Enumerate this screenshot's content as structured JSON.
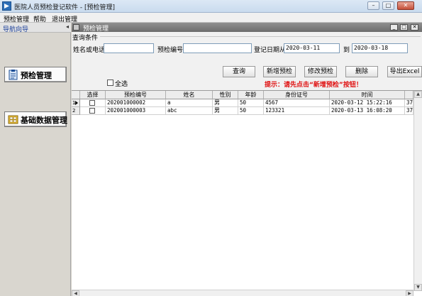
{
  "window": {
    "title": "医院人员预检登记软件 - [预检管理]",
    "minimize_glyph": "–",
    "maximize_glyph": "□",
    "close_glyph": "✕"
  },
  "menubar": {
    "items": [
      "预检管理",
      "帮助",
      "退出管理"
    ]
  },
  "sidebar": {
    "title": "导航向导",
    "collapse_glyph": "◂",
    "buttons": [
      {
        "label": "预检管理",
        "icon": "clipboard-icon"
      },
      {
        "label": "基础数据管理",
        "icon": "database-icon"
      }
    ]
  },
  "child_window": {
    "title": "预检管理",
    "buttons": [
      "_",
      "□",
      "✕"
    ]
  },
  "query": {
    "group_label": "查询条件",
    "name_phone_label": "姓名或电话",
    "name_phone_value": "",
    "precheck_no_label": "预检编号",
    "precheck_no_value": "",
    "date_from_label": "登记日期从",
    "date_from_value": "2020-03-11",
    "date_to_label": "到",
    "date_to_value": "2020-03-18"
  },
  "actions": {
    "query": "查询",
    "add": "新增预检",
    "edit": "修改预检",
    "delete": "删除",
    "export": "导出Excel"
  },
  "select_all_label": "全选",
  "hint": "提示：请先点击“新增预检”按钮！",
  "table": {
    "columns": [
      "选择",
      "预检编号",
      "姓名",
      "性别",
      "年龄",
      "身份证号",
      "时间",
      ""
    ],
    "rows": [
      {
        "index": "1",
        "precheck_no": "202001000002",
        "name": "a",
        "gender": "男",
        "age": "50",
        "id_no": "4567",
        "time": "2020-03-12 15:22:16",
        "extra": "37"
      },
      {
        "index": "2",
        "precheck_no": "202001000003",
        "name": "abc",
        "gender": "男",
        "age": "50",
        "id_no": "123321",
        "time": "2020-03-13 16:08:20",
        "extra": "37"
      }
    ]
  },
  "colors": {
    "hint": "#e01010",
    "nav_title": "#1b3f9a",
    "mdi_titlebar": "#7a7a7a"
  }
}
